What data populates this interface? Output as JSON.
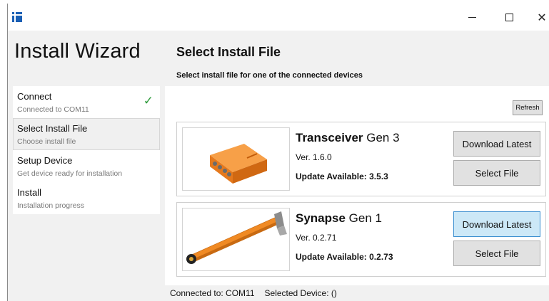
{
  "window": {
    "minimize_glyph": "",
    "maximize_glyph": "",
    "close_glyph": "✕"
  },
  "sidebar": {
    "app_title": "Install Wizard",
    "steps": [
      {
        "title": "Connect",
        "subtitle": "Connected to COM11",
        "completed": true,
        "check": "✓"
      },
      {
        "title": "Select Install File",
        "subtitle": "Choose install file",
        "active": true
      },
      {
        "title": "Setup Device",
        "subtitle": "Get device ready for installation"
      },
      {
        "title": "Install",
        "subtitle": "Installation progress"
      }
    ]
  },
  "main": {
    "title": "Select Install File",
    "subtitle": "Select install file for one of the connected devices",
    "refresh_label": "Refresh",
    "devices": [
      {
        "name_bold": "Transceiver",
        "name_rest": " Gen 3",
        "version": "Ver. 1.6.0",
        "update": "Update Available: 3.5.3",
        "download_label": "Download Latest",
        "select_label": "Select File",
        "image": "orange-box-device"
      },
      {
        "name_bold": "Synapse",
        "name_rest": " Gen 1",
        "version": "Ver. 0.2.71",
        "update": "Update Available: 0.2.73",
        "download_label": "Download Latest",
        "select_label": "Select File",
        "image": "orange-probe-device"
      }
    ]
  },
  "status": {
    "connected": "Connected to: COM11",
    "selected_device": "Selected Device: ()"
  },
  "colors": {
    "device_orange": "#f08a24",
    "highlight_button": "#cce8f7",
    "check_green": "#2e9b3b",
    "app_icon_blue": "#1a5fb4"
  }
}
